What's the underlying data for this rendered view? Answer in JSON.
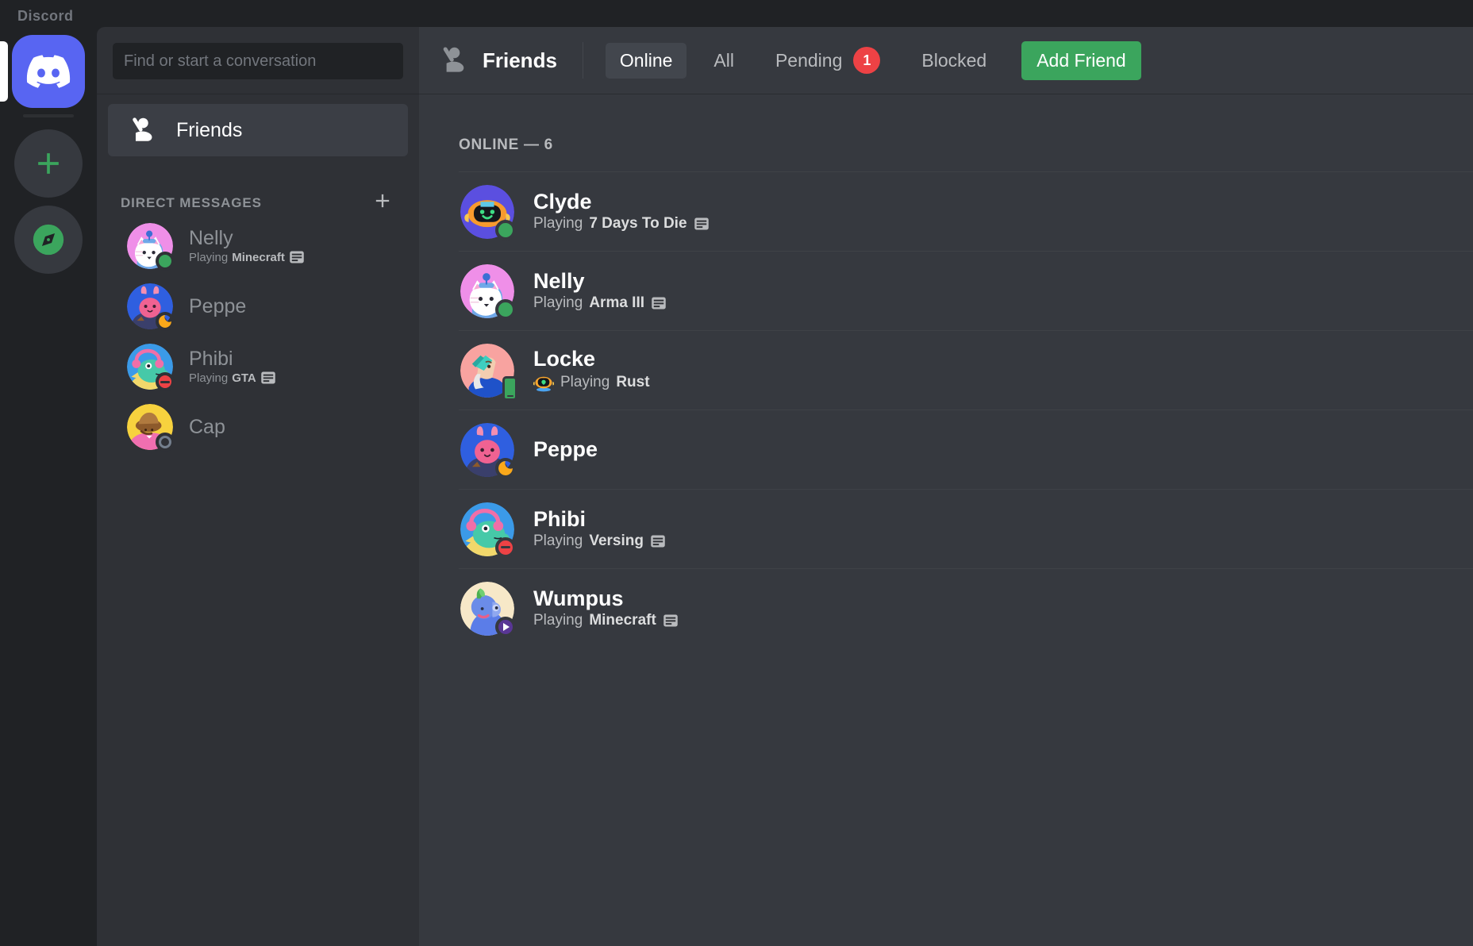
{
  "window": {
    "title": "Discord"
  },
  "server_rail": {
    "home_label": "Discord Home",
    "add_server_label": "Add a Server",
    "explore_label": "Explore Public Servers"
  },
  "sidebar": {
    "search": {
      "placeholder": "Find or start a conversation",
      "value": ""
    },
    "friends_item": {
      "label": "Friends",
      "icon": "friends-wave-icon",
      "active": true
    },
    "dm_section": {
      "label": "DIRECT MESSAGES",
      "add_icon": "plus-icon"
    },
    "dms": [
      {
        "name": "Nelly",
        "activity_prefix": "Playing",
        "activity": "Minecraft",
        "has_activity_icon": true,
        "status": "online",
        "avatar": "nelly"
      },
      {
        "name": "Peppe",
        "activity_prefix": "",
        "activity": "",
        "has_activity_icon": false,
        "status": "idle",
        "avatar": "peppe"
      },
      {
        "name": "Phibi",
        "activity_prefix": "Playing",
        "activity": "GTA",
        "has_activity_icon": true,
        "status": "dnd",
        "avatar": "phibi"
      },
      {
        "name": "Cap",
        "activity_prefix": "",
        "activity": "",
        "has_activity_icon": false,
        "status": "offline",
        "avatar": "cap"
      }
    ]
  },
  "main": {
    "header": {
      "icon": "friends-wave-icon",
      "title": "Friends",
      "tabs": [
        {
          "label": "Online",
          "active": true,
          "badge": null
        },
        {
          "label": "All",
          "active": false,
          "badge": null
        },
        {
          "label": "Pending",
          "active": false,
          "badge": "1"
        },
        {
          "label": "Blocked",
          "active": false,
          "badge": null
        }
      ],
      "add_friend_label": "Add Friend"
    },
    "online_count_label": "ONLINE — 6",
    "friends": [
      {
        "name": "Clyde",
        "activity_prefix": "Playing",
        "activity": "7 Days To Die",
        "has_activity_icon": true,
        "has_emoji": false,
        "status": "online",
        "avatar": "clyde"
      },
      {
        "name": "Nelly",
        "activity_prefix": "Playing",
        "activity": "Arma III",
        "has_activity_icon": true,
        "has_emoji": false,
        "status": "online",
        "avatar": "nelly"
      },
      {
        "name": "Locke",
        "activity_prefix": "Playing",
        "activity": "Rust",
        "has_activity_icon": false,
        "has_emoji": true,
        "status": "mobile",
        "avatar": "locke"
      },
      {
        "name": "Peppe",
        "activity_prefix": "",
        "activity": "",
        "has_activity_icon": false,
        "has_emoji": false,
        "status": "idle",
        "avatar": "peppe"
      },
      {
        "name": "Phibi",
        "activity_prefix": "Playing",
        "activity": "Versing",
        "has_activity_icon": true,
        "has_emoji": false,
        "status": "dnd",
        "avatar": "phibi"
      },
      {
        "name": "Wumpus",
        "activity_prefix": "Playing",
        "activity": "Minecraft",
        "has_activity_icon": true,
        "has_emoji": false,
        "status": "stream",
        "avatar": "wumpus"
      }
    ]
  },
  "colors": {
    "brand": "#5865f2",
    "online": "#3ba55d",
    "idle": "#faa81a",
    "dnd": "#ed4245",
    "offline": "#747f8d",
    "stream": "#593695",
    "sidebar_bg": "#2f3136",
    "main_bg": "#36393f",
    "rail_bg": "#202225"
  }
}
